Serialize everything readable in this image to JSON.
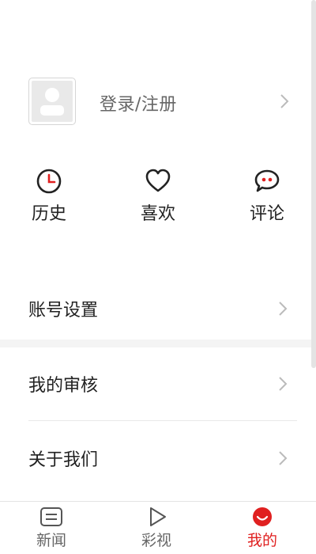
{
  "profile": {
    "login_label": "登录/注册"
  },
  "actions": [
    {
      "label": "历史",
      "icon": "clock-icon"
    },
    {
      "label": "喜欢",
      "icon": "heart-icon"
    },
    {
      "label": "评论",
      "icon": "comment-icon"
    }
  ],
  "menu": [
    {
      "label": "账号设置"
    },
    {
      "label": "我的审核"
    },
    {
      "label": "关于我们"
    }
  ],
  "tabbar": {
    "tabs": [
      {
        "label": "新闻",
        "icon": "news-icon",
        "active": false
      },
      {
        "label": "彩视",
        "icon": "play-icon",
        "active": false
      },
      {
        "label": "我的",
        "icon": "profile-smile-icon",
        "active": true
      }
    ]
  },
  "colors": {
    "accent": "#e02020",
    "text": "#222222",
    "muted": "#666666",
    "chevron": "#bbbbbb"
  }
}
